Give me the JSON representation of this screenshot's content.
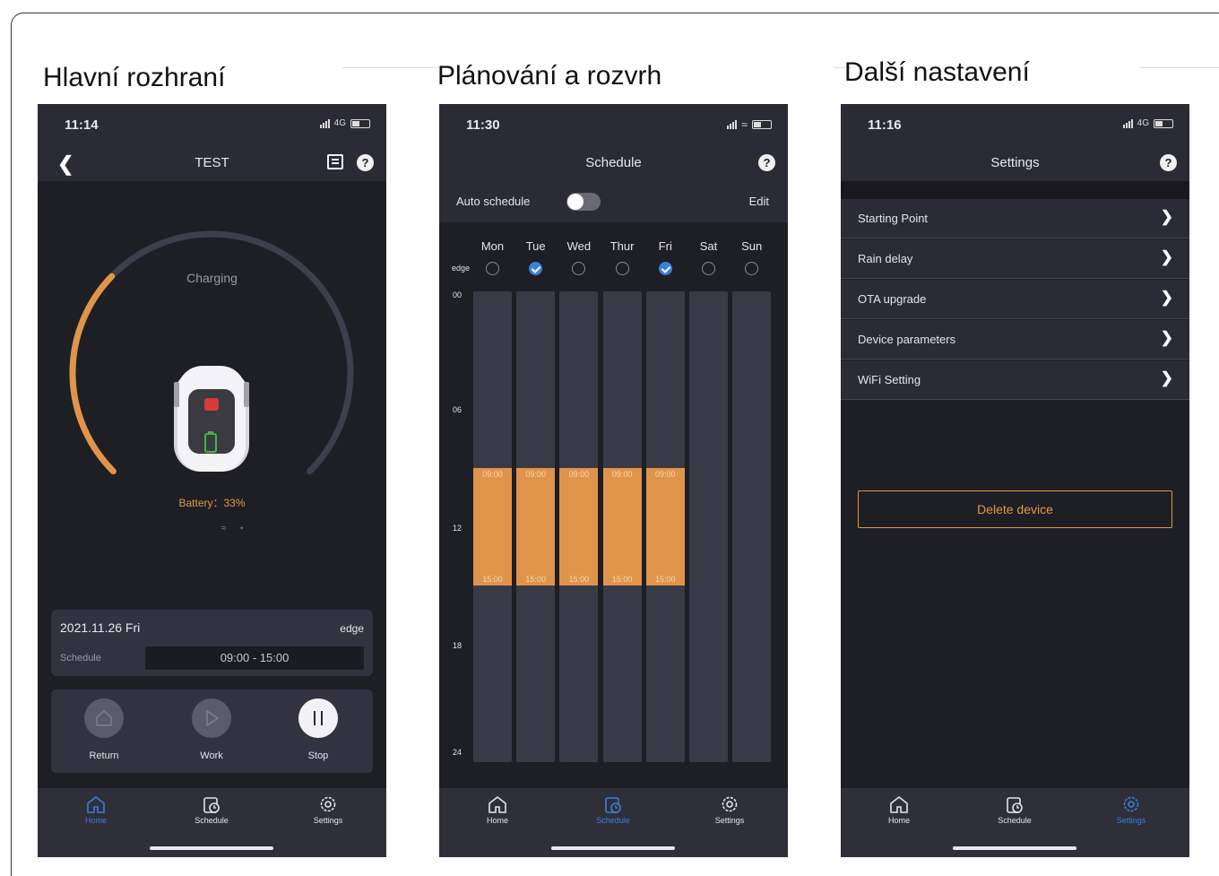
{
  "captions": [
    "Hlavní rozhraní",
    "Plánování a rozvrh",
    "Další nastavení"
  ],
  "screen1": {
    "status_time": "11:14",
    "network": "4G",
    "title": "TEST",
    "gauge_label": "Charging",
    "battery_level": 0.33,
    "battery_text": "Battery：33%",
    "date": "2021.11.26 Fri",
    "mode": "edge",
    "schedule_label": "Schedule",
    "schedule_value": "09:00 - 15:00",
    "controls": [
      {
        "label": "Return",
        "icon": "home-icon",
        "active": false
      },
      {
        "label": "Work",
        "icon": "play-icon",
        "active": false
      },
      {
        "label": "Stop",
        "icon": "pause-icon",
        "active": true
      }
    ]
  },
  "screen2": {
    "status_time": "11:30",
    "title": "Schedule",
    "auto_schedule_label": "Auto schedule",
    "auto_schedule_on": false,
    "edit_label": "Edit",
    "edge_label": "edge",
    "days": [
      {
        "name": "Mon",
        "edge": false,
        "start": "09:00",
        "end": "15:00"
      },
      {
        "name": "Tue",
        "edge": true,
        "start": "09:00",
        "end": "15:00"
      },
      {
        "name": "Wed",
        "edge": false,
        "start": "09:00",
        "end": "15:00"
      },
      {
        "name": "Thur",
        "edge": false,
        "start": "09:00",
        "end": "15:00"
      },
      {
        "name": "Fri",
        "edge": true,
        "start": "09:00",
        "end": "15:00"
      },
      {
        "name": "Sat",
        "edge": false,
        "start": null,
        "end": null
      },
      {
        "name": "Sun",
        "edge": false,
        "start": null,
        "end": null
      }
    ],
    "hours": [
      "00",
      "06",
      "12",
      "18",
      "24"
    ]
  },
  "screen3": {
    "status_time": "11:16",
    "network": "4G",
    "title": "Settings",
    "items": [
      "Starting Point",
      "Rain delay",
      "OTA upgrade",
      "Device parameters",
      "WiFi Setting"
    ],
    "delete_label": "Delete device"
  },
  "tabs": [
    "Home",
    "Schedule",
    "Settings"
  ],
  "colors": {
    "accent_orange": "#e0944a",
    "accent_blue": "#3c7fd6",
    "background": "#1e1e25",
    "panel": "#2b2b36"
  }
}
